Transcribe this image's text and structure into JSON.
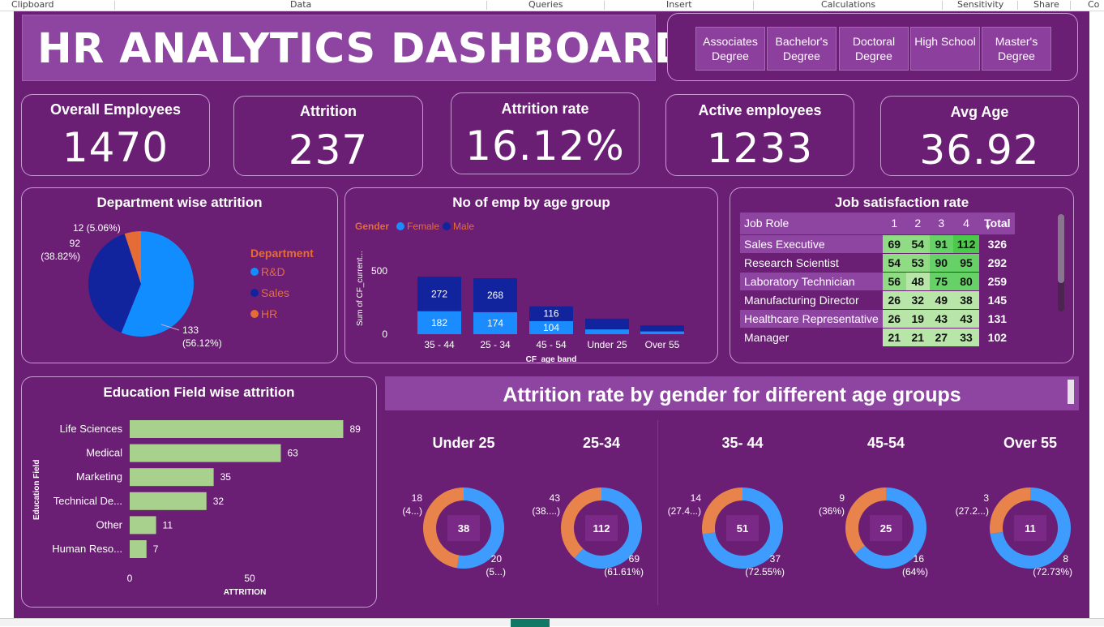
{
  "ribbon": {
    "items": [
      "Clipboard",
      "Data",
      "Queries",
      "Insert",
      "Calculations",
      "Sensitivity",
      "Share",
      "Co"
    ]
  },
  "header": {
    "title": "HR ANALYTICS DASHBOARD"
  },
  "education_slicer": {
    "options": [
      "Associates Degree",
      "Bachelor's Degree",
      "Doctoral Degree",
      "High School",
      "Master's Degree"
    ]
  },
  "kpis": [
    {
      "label": "Overall Employees",
      "value": "1470"
    },
    {
      "label": "Attrition",
      "value": "237"
    },
    {
      "label": "Attrition rate",
      "value": "16.12%"
    },
    {
      "label": "Active employees",
      "value": "1233"
    },
    {
      "label": "Avg Age",
      "value": "36.92"
    }
  ],
  "colors": {
    "background": "#6a1f74",
    "rnd": "#118dff",
    "sales": "#12239e",
    "hr": "#e66c37",
    "female": "#1a8cff",
    "male": "#12239e",
    "bar_green": "#a9d18e",
    "donut_male": "#3f9cff",
    "donut_female": "#e8844b"
  },
  "department_attrition": {
    "title": "Department wise attrition",
    "legend_title": "Department",
    "labels": {
      "hr": "12 (5.06%)",
      "sales_count": "92",
      "sales_pct": "(38.82%)",
      "rnd_count": "133",
      "rnd_pct": "(56.12%)"
    }
  },
  "age_group_chart": {
    "title": "No of emp by age group",
    "legend_title": "Gender",
    "female_label": "Female",
    "male_label": "Male",
    "ylabel": "Sum of CF_current...",
    "xlabel": "CF_age band",
    "y_ticks": [
      "500",
      "0"
    ]
  },
  "job_satisfaction": {
    "title": "Job satisfaction rate",
    "columns": [
      "Job Role",
      "1",
      "2",
      "3",
      "4",
      "Total"
    ],
    "rows": [
      {
        "role": "Sales Executive",
        "v1": "69",
        "v2": "54",
        "v3": "91",
        "v4": "112",
        "total": "326"
      },
      {
        "role": "Research Scientist",
        "v1": "54",
        "v2": "53",
        "v3": "90",
        "v4": "95",
        "total": "292"
      },
      {
        "role": "Laboratory Technician",
        "v1": "56",
        "v2": "48",
        "v3": "75",
        "v4": "80",
        "total": "259"
      },
      {
        "role": "Manufacturing Director",
        "v1": "26",
        "v2": "32",
        "v3": "49",
        "v4": "38",
        "total": "145"
      },
      {
        "role": "Healthcare Representative",
        "v1": "26",
        "v2": "19",
        "v3": "43",
        "v4": "43",
        "total": "131"
      },
      {
        "role": "Manager",
        "v1": "21",
        "v2": "21",
        "v3": "27",
        "v4": "33",
        "total": "102"
      }
    ]
  },
  "education_attrition": {
    "title": "Education Field wise attrition",
    "ylabel": "Education Field",
    "xlabel": "ATTRITION",
    "x_ticks": [
      "0",
      "50"
    ]
  },
  "gender_age_title": "Attrition rate by gender for different age groups",
  "chart_data": [
    {
      "type": "pie",
      "title": "Department wise attrition",
      "legend": "Department",
      "categories": [
        "R&D",
        "Sales",
        "HR"
      ],
      "values": [
        133,
        92,
        12
      ],
      "percentages": [
        56.12,
        38.82,
        5.06
      ]
    },
    {
      "type": "bar",
      "title": "No of emp by age group",
      "xlabel": "CF_age band",
      "ylabel": "Sum of CF_current...",
      "categories": [
        "35 - 44",
        "25 - 34",
        "45 - 54",
        "Under 25",
        "Over 55"
      ],
      "series": [
        {
          "name": "Female",
          "values": [
            182,
            174,
            104,
            38,
            22
          ]
        },
        {
          "name": "Male",
          "values": [
            272,
            268,
            116,
            85,
            47
          ]
        }
      ],
      "ylim": [
        0,
        500
      ]
    },
    {
      "type": "bar",
      "title": "Education Field wise attrition",
      "xlabel": "ATTRITION",
      "ylabel": "Education Field",
      "categories": [
        "Life Sciences",
        "Medical",
        "Marketing",
        "Technical De...",
        "Other",
        "Human Reso..."
      ],
      "values": [
        89,
        63,
        35,
        32,
        11,
        7
      ],
      "xlim": [
        0,
        100
      ]
    },
    {
      "type": "pie",
      "title": "Under 25",
      "total": "38",
      "series": [
        {
          "name": "Female",
          "value": 18,
          "label": "18",
          "label_pct": "(4...)"
        },
        {
          "name": "Male",
          "value": 20,
          "label": "20",
          "label_pct": "(5...)"
        }
      ]
    },
    {
      "type": "pie",
      "title": "25-34",
      "total": "112",
      "series": [
        {
          "name": "Female",
          "value": 43,
          "label": "43",
          "label_pct": "(38....)"
        },
        {
          "name": "Male",
          "value": 69,
          "label": "69",
          "label_pct": "(61.61%)"
        }
      ]
    },
    {
      "type": "pie",
      "title": "35- 44",
      "total": "51",
      "series": [
        {
          "name": "Female",
          "value": 14,
          "label": "14",
          "label_pct": "(27.4...)"
        },
        {
          "name": "Male",
          "value": 37,
          "label": "37",
          "label_pct": "(72.55%)"
        }
      ]
    },
    {
      "type": "pie",
      "title": "45-54",
      "total": "25",
      "series": [
        {
          "name": "Female",
          "value": 9,
          "label": "9",
          "label_pct": "(36%)"
        },
        {
          "name": "Male",
          "value": 16,
          "label": "16",
          "label_pct": "(64%)"
        }
      ]
    },
    {
      "type": "pie",
      "title": "Over 55",
      "total": "11",
      "series": [
        {
          "name": "Female",
          "value": 3,
          "label": "3",
          "label_pct": "(27.2...)"
        },
        {
          "name": "Male",
          "value": 8,
          "label": "8",
          "label_pct": "(72.73%)"
        }
      ]
    }
  ]
}
